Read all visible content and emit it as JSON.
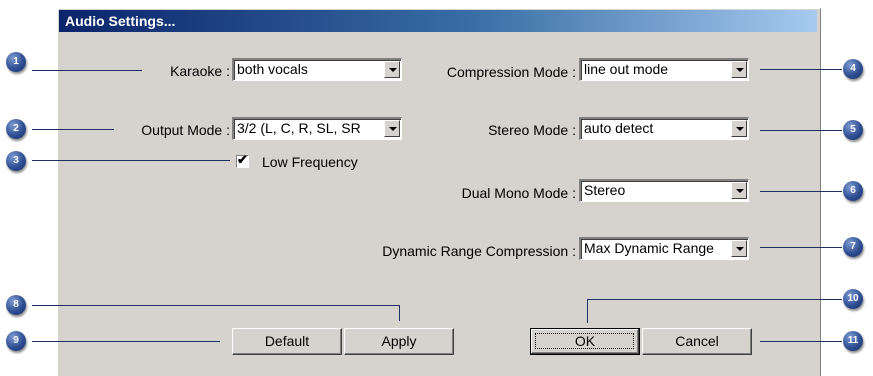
{
  "dialog": {
    "title": "Audio Settings..."
  },
  "fields": {
    "karaoke": {
      "label": "Karaoke :",
      "value": "both vocals"
    },
    "output_mode": {
      "label": "Output Mode :",
      "value": "3/2 (L, C, R, SL, SR"
    },
    "low_frequency": {
      "label": "Low Frequency",
      "checked": true,
      "mark": "✔"
    },
    "compression_mode": {
      "label": "Compression Mode :",
      "value": "line out mode"
    },
    "stereo_mode": {
      "label": "Stereo Mode :",
      "value": "auto detect"
    },
    "dual_mono_mode": {
      "label": "Dual Mono Mode :",
      "value": "Stereo"
    },
    "dynamic_range": {
      "label": "Dynamic Range Compression :",
      "value": "Max Dynamic Range"
    }
  },
  "buttons": {
    "default": "Default",
    "apply": "Apply",
    "ok": "OK",
    "cancel": "Cancel"
  },
  "callouts": [
    "1",
    "2",
    "3",
    "4",
    "5",
    "6",
    "7",
    "8",
    "9",
    "10",
    "11"
  ],
  "colors": {
    "callout": "#2f4f93",
    "dialog_bg": "#d6d3ce",
    "title_start": "#0a246a",
    "title_end": "#a6caf0"
  }
}
